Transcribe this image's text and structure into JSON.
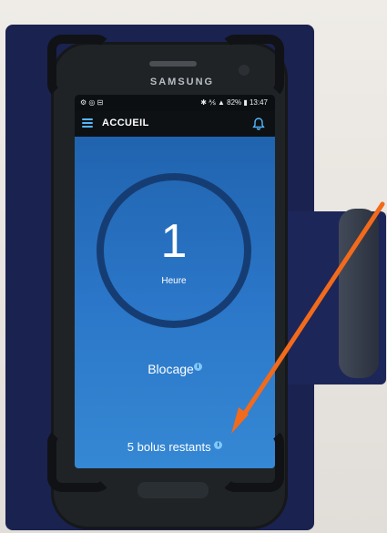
{
  "device": {
    "brand": "SAMSUNG"
  },
  "statusbar": {
    "left_icons": "⚙ ◎ ⊟",
    "right_text": "✱ ⅍ ▲ 82% ▮ 13:47"
  },
  "appbar": {
    "title": "ACCUEIL"
  },
  "timer": {
    "value": "1",
    "unit": "Heure"
  },
  "status": {
    "label": "Blocage"
  },
  "remaining": {
    "text": "5 bolus restants"
  },
  "colors": {
    "accent": "#53b8ff",
    "arrow": "#f26a1b",
    "screen_top": "#1d5fa8",
    "screen_bottom": "#3588d4"
  }
}
